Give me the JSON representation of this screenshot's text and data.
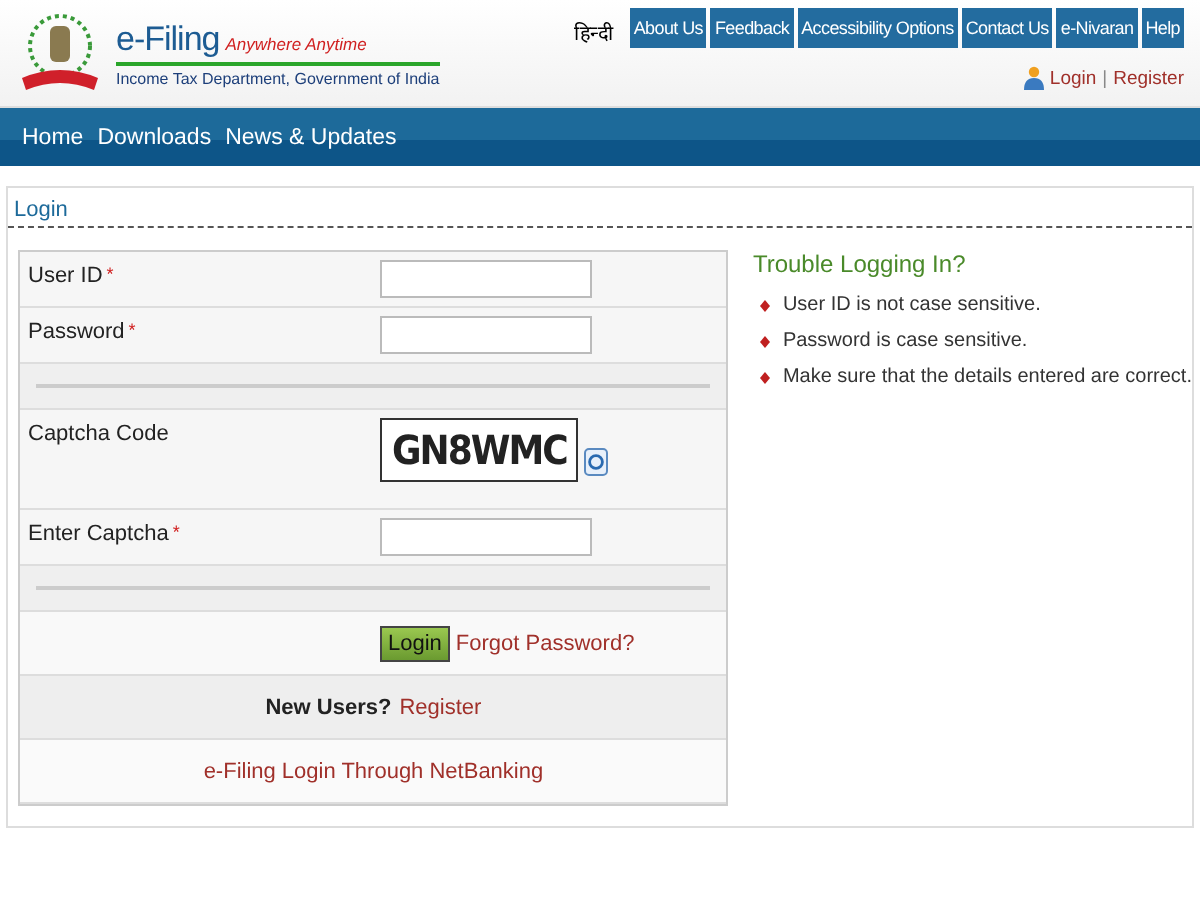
{
  "header": {
    "brand": "e-Filing",
    "tagline": "Anywhere Anytime",
    "department": "Income Tax Department, Government of India",
    "language_link": "हिन्दी",
    "top_tabs": [
      {
        "label": "About Us"
      },
      {
        "label": "Feedback"
      },
      {
        "label": "Accessibility Options"
      },
      {
        "label": "Contact Us"
      },
      {
        "label": "e-Nivaran"
      },
      {
        "label": "Help"
      }
    ],
    "login_link": "Login",
    "link_separator": "|",
    "register_link": "Register"
  },
  "required_mark": "*",
  "nav": [
    "Home",
    "Downloads",
    "News & Updates"
  ],
  "panel_title": "Login",
  "form": [
    {
      "kind": "field",
      "label": "User ID",
      "required": true
    },
    {
      "kind": "field",
      "label": "Password",
      "required": true
    },
    {
      "kind": "separator"
    },
    {
      "kind": "captcha",
      "label": "Captcha Code",
      "code": "GN8WMC"
    },
    {
      "kind": "field",
      "label": "Enter Captcha",
      "required": true
    },
    {
      "kind": "separator"
    }
  ],
  "login_button": "Login",
  "forgot_link": "Forgot Password?",
  "new_users_label": "New Users?",
  "new_users_link": "Register",
  "netbanking_link": "e-Filing Login Through NetBanking",
  "help": {
    "title": "Trouble Logging In?",
    "tips": [
      "User ID is not case sensitive.",
      "Password is case sensitive.",
      "Make sure that the details entered are correct."
    ]
  }
}
